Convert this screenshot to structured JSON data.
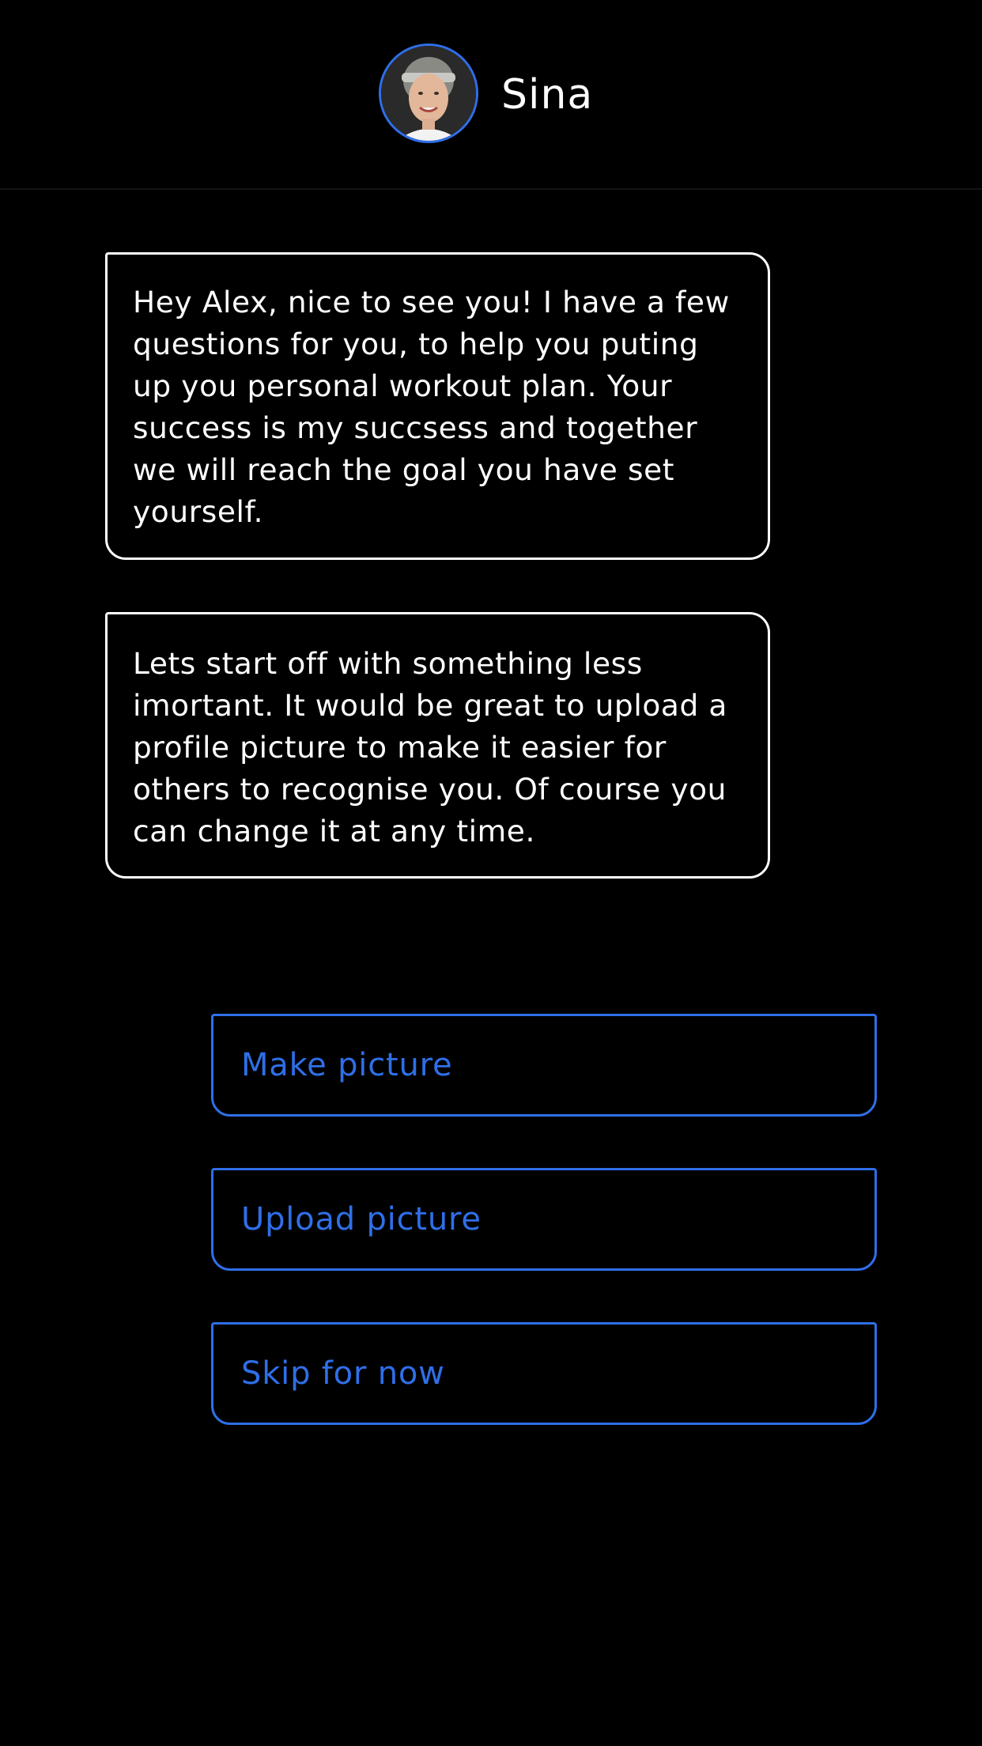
{
  "header": {
    "contact_name": "Sina",
    "avatar_icon": "profile-photo"
  },
  "messages": [
    {
      "text": "Hey Alex, nice to see you! I have a few questions for you, to help you puting up you personal workout plan. Your success is my succsess and together we will reach the goal you have set yourself."
    },
    {
      "text": "Lets start off with something less imortant. It would be great to upload a profile picture to make it easier for others to recognise you. Of course you can change it at any time."
    }
  ],
  "options": [
    {
      "label": "Make picture"
    },
    {
      "label": "Upload picture"
    },
    {
      "label": "Skip for now"
    }
  ],
  "colors": {
    "background": "#000000",
    "accent": "#2f6fe8",
    "text": "#ffffff"
  }
}
